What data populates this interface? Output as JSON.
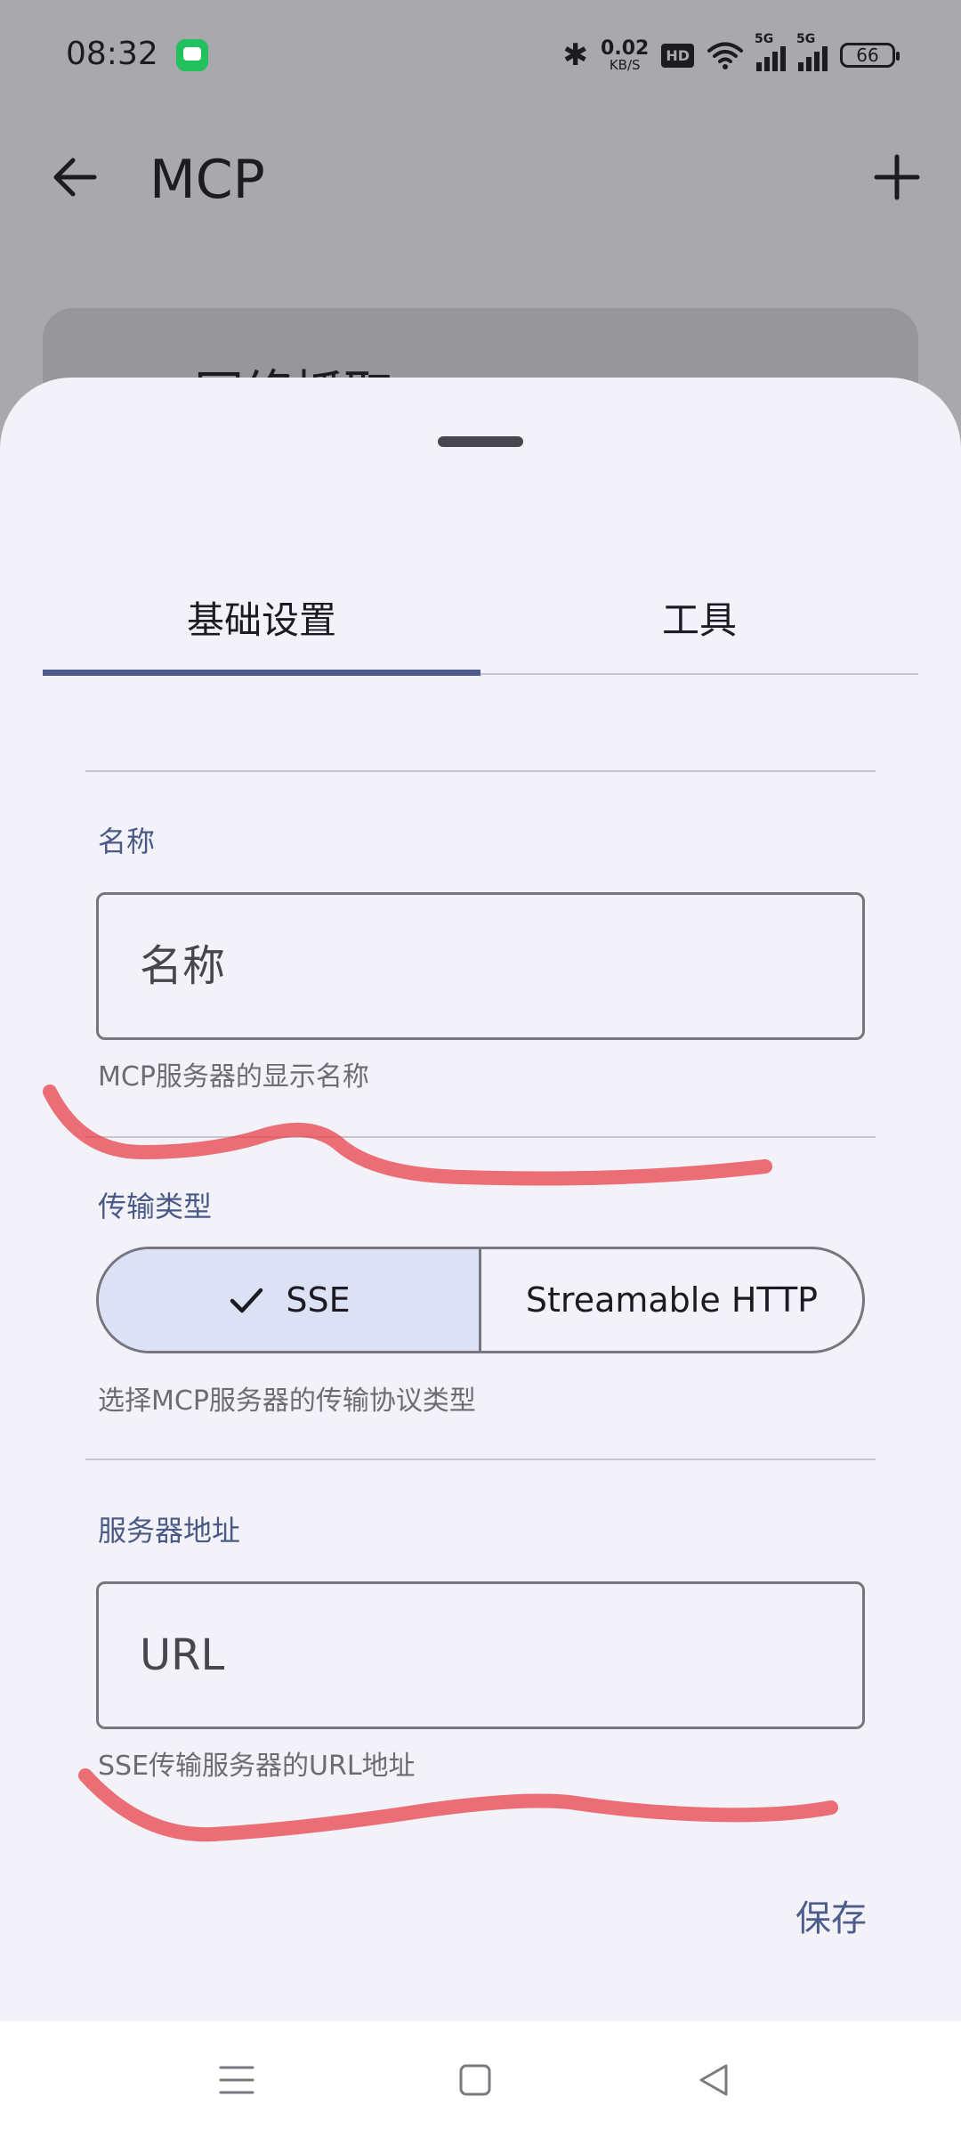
{
  "status_bar": {
    "time": "08:32",
    "net_speed": "0.02",
    "net_unit": "KB/S",
    "hd_label": "HD",
    "signal_1_label": "5G",
    "signal_2_label": "5G",
    "battery": "66"
  },
  "app_bar": {
    "title": "MCP",
    "background_card_title": "网络抓取"
  },
  "sheet": {
    "tabs": [
      {
        "label": "基础设置",
        "selected": true
      },
      {
        "label": "工具",
        "selected": false
      }
    ],
    "name_field": {
      "label": "名称",
      "placeholder": "名称",
      "helper": "MCP服务器的显示名称"
    },
    "transport": {
      "label": "传输类型",
      "options": [
        {
          "label": "SSE",
          "selected": true
        },
        {
          "label": "Streamable HTTP",
          "selected": false
        }
      ],
      "helper": "选择MCP服务器的传输协议类型"
    },
    "url_field": {
      "label": "服务器地址",
      "placeholder": "URL",
      "helper": "SSE传输服务器的URL地址"
    },
    "save_label": "保存"
  },
  "colors": {
    "accent": "#4c5d8c",
    "selected_segment": "#dce1f5",
    "scribble": "#e8404a"
  },
  "icons": {
    "back": "arrow-left-icon",
    "add": "plus-icon",
    "check": "check-icon",
    "nav_menu": "menu-icon",
    "nav_home": "home-square-icon",
    "nav_back": "back-triangle-icon"
  }
}
